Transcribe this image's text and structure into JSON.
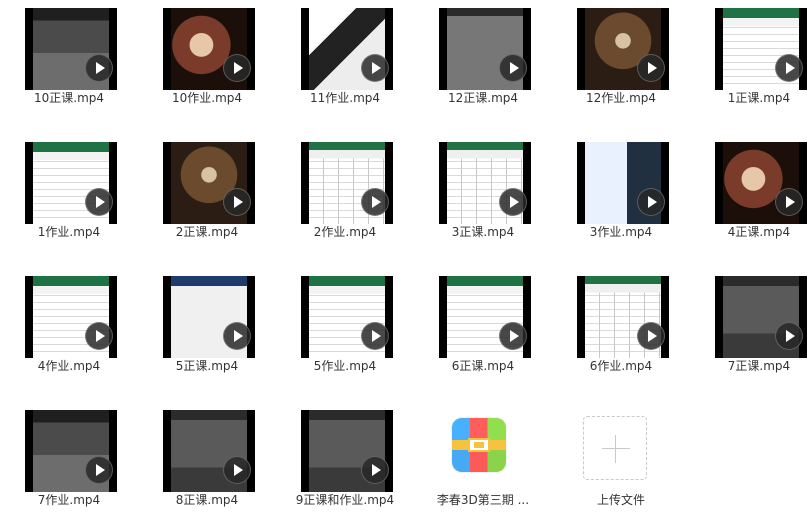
{
  "files": [
    {
      "name": "10正课.mp4",
      "style": "t-dark3d"
    },
    {
      "name": "10作业.mp4",
      "style": "t-photo-warm"
    },
    {
      "name": "11作业.mp4",
      "style": "t-photo-bw"
    },
    {
      "name": "12正课.mp4",
      "style": "t-gray"
    },
    {
      "name": "12作业.mp4",
      "style": "t-photo-sepia"
    },
    {
      "name": "1正课.mp4",
      "style": "t-excel"
    },
    {
      "name": "1作业.mp4",
      "style": "t-excel"
    },
    {
      "name": "2正课.mp4",
      "style": "t-photo-sepia"
    },
    {
      "name": "2作业.mp4",
      "style": "t-excel-x"
    },
    {
      "name": "3正课.mp4",
      "style": "t-excel-x"
    },
    {
      "name": "3作业.mp4",
      "style": "t-mixed"
    },
    {
      "name": "4正课.mp4",
      "style": "t-photo-warm"
    },
    {
      "name": "4作业.mp4",
      "style": "t-excel"
    },
    {
      "name": "5正课.mp4",
      "style": "t-blue-ui"
    },
    {
      "name": "5作业.mp4",
      "style": "t-excel"
    },
    {
      "name": "6正课.mp4",
      "style": "t-excel"
    },
    {
      "name": "6作业.mp4",
      "style": "t-excel-x"
    },
    {
      "name": "7正课.mp4",
      "style": "t-dark-ui"
    },
    {
      "name": "7作业.mp4",
      "style": "t-dark3d"
    },
    {
      "name": "8正课.mp4",
      "style": "t-dark-ui"
    },
    {
      "name": "9正课和作业.mp4",
      "style": "t-dark-ui"
    }
  ],
  "archive": {
    "name": "李春3D第三期 ..."
  },
  "upload": {
    "label": "上传文件"
  }
}
